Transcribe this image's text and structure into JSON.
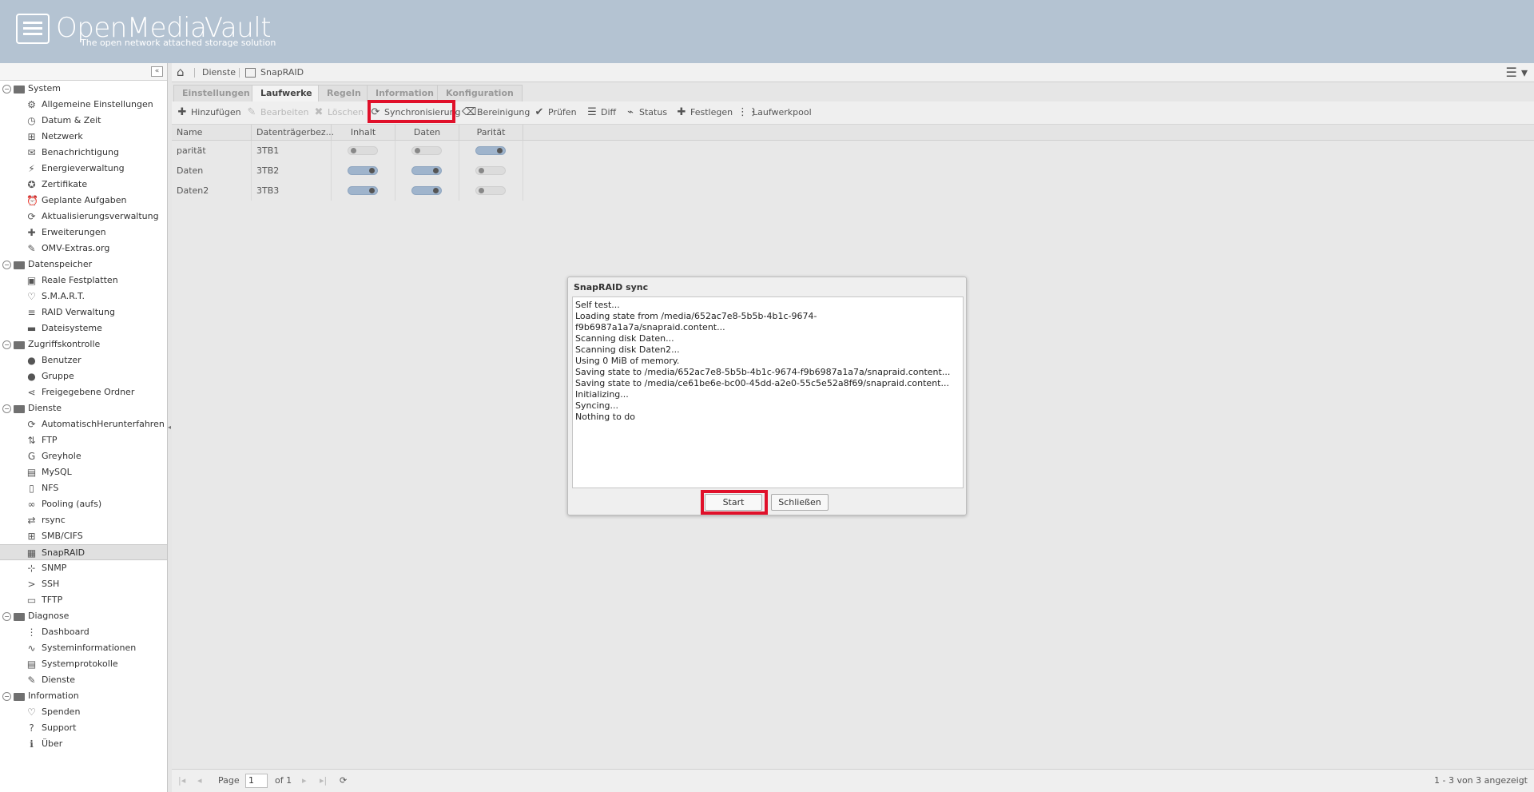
{
  "header": {
    "title": "OpenMediaVault",
    "subtitle": "The open network attached storage solution"
  },
  "sidebar": {
    "collapse_glyph": "«",
    "groups": [
      {
        "label": "System",
        "items": [
          {
            "label": "Allgemeine Einstellungen",
            "icon": "⚙"
          },
          {
            "label": "Datum & Zeit",
            "icon": "◷"
          },
          {
            "label": "Netzwerk",
            "icon": "⊞"
          },
          {
            "label": "Benachrichtigung",
            "icon": "✉"
          },
          {
            "label": "Energieverwaltung",
            "icon": "⚡"
          },
          {
            "label": "Zertifikate",
            "icon": "✪"
          },
          {
            "label": "Geplante Aufgaben",
            "icon": "⏰"
          },
          {
            "label": "Aktualisierungsverwaltung",
            "icon": "⟳"
          },
          {
            "label": "Erweiterungen",
            "icon": "✚"
          },
          {
            "label": "OMV-Extras.org",
            "icon": "✎"
          }
        ]
      },
      {
        "label": "Datenspeicher",
        "items": [
          {
            "label": "Reale Festplatten",
            "icon": "▣"
          },
          {
            "label": "S.M.A.R.T.",
            "icon": "♡"
          },
          {
            "label": "RAID Verwaltung",
            "icon": "≡"
          },
          {
            "label": "Dateisysteme",
            "icon": "▬"
          }
        ]
      },
      {
        "label": "Zugriffskontrolle",
        "items": [
          {
            "label": "Benutzer",
            "icon": "●"
          },
          {
            "label": "Gruppe",
            "icon": "●"
          },
          {
            "label": "Freigegebene Ordner",
            "icon": "⋖"
          }
        ]
      },
      {
        "label": "Dienste",
        "items": [
          {
            "label": "AutomatischHerunterfahren",
            "icon": "⟳"
          },
          {
            "label": "FTP",
            "icon": "⇅"
          },
          {
            "label": "Greyhole",
            "icon": "G"
          },
          {
            "label": "MySQL",
            "icon": "▤"
          },
          {
            "label": "NFS",
            "icon": "▯"
          },
          {
            "label": "Pooling (aufs)",
            "icon": "∞"
          },
          {
            "label": "rsync",
            "icon": "⇄"
          },
          {
            "label": "SMB/CIFS",
            "icon": "⊞"
          },
          {
            "label": "SnapRAID",
            "icon": "▦"
          },
          {
            "label": "SNMP",
            "icon": "⊹"
          },
          {
            "label": "SSH",
            "icon": ">"
          },
          {
            "label": "TFTP",
            "icon": "▭"
          }
        ]
      },
      {
        "label": "Diagnose",
        "items": [
          {
            "label": "Dashboard",
            "icon": "⋮"
          },
          {
            "label": "Systeminformationen",
            "icon": "∿"
          },
          {
            "label": "Systemprotokolle",
            "icon": "▤"
          },
          {
            "label": "Dienste",
            "icon": "✎"
          }
        ]
      },
      {
        "label": "Information",
        "items": [
          {
            "label": "Spenden",
            "icon": "♡"
          },
          {
            "label": "Support",
            "icon": "?"
          },
          {
            "label": "Über",
            "icon": "ℹ"
          }
        ]
      }
    ],
    "selected": "SnapRAID"
  },
  "breadcrumb": {
    "items": [
      "Dienste",
      "SnapRAID"
    ]
  },
  "tabs": [
    "Einstellungen",
    "Laufwerke",
    "Regeln",
    "Information",
    "Konfiguration"
  ],
  "active_tab": "Laufwerke",
  "toolbar": {
    "add": "Hinzufügen",
    "edit": "Bearbeiten",
    "delete": "Löschen",
    "sync": "Synchronisierung",
    "clean": "Bereinigung",
    "check": "Prüfen",
    "diff": "Diff",
    "status": "Status",
    "fix": "Festlegen",
    "pool": "Laufwerkpool"
  },
  "grid": {
    "columns": [
      "Name",
      "Datenträgerbez...",
      "Inhalt",
      "Daten",
      "Parität"
    ],
    "rows": [
      {
        "name": "parität",
        "label": "3TB1",
        "content": false,
        "data": false,
        "parity": true
      },
      {
        "name": "Daten",
        "label": "3TB2",
        "content": true,
        "data": true,
        "parity": false
      },
      {
        "name": "Daten2",
        "label": "3TB3",
        "content": true,
        "data": true,
        "parity": false
      }
    ]
  },
  "pager": {
    "page_label": "Page",
    "page_value": "1",
    "of_label": "of 1",
    "summary": "1 - 3 von 3 angezeigt"
  },
  "dialog": {
    "title": "SnapRAID sync",
    "log": [
      "Self test...",
      "Loading state from /media/652ac7e8-5b5b-4b1c-9674-",
      "f9b6987a1a7a/snapraid.content...",
      "Scanning disk Daten...",
      "Scanning disk Daten2...",
      "Using 0 MiB of memory.",
      "Saving state to /media/652ac7e8-5b5b-4b1c-9674-f9b6987a1a7a/snapraid.content...",
      "Saving state to /media/ce61be6e-bc00-45dd-a2e0-55c5e52a8f69/snapraid.content...",
      "Initializing...",
      "Syncing...",
      "Nothing to do"
    ],
    "start_label": "Start",
    "close_label": "Schließen"
  },
  "colors": {
    "header_bg": "#b4c3d2",
    "highlight": "#e0102a",
    "toggle_on": "#9fb4cc"
  }
}
